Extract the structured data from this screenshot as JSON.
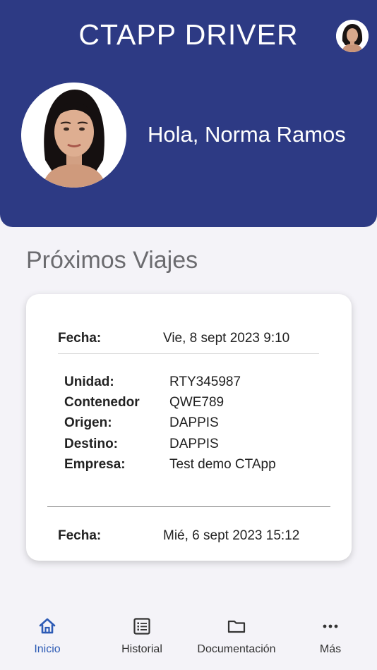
{
  "header": {
    "title": "CTAPP DRIVER",
    "greeting": "Hola, Norma Ramos"
  },
  "section": {
    "title": "Próximos Viajes"
  },
  "trips": [
    {
      "fecha_label": "Fecha:",
      "fecha_value": "Vie, 8 sept 2023 9:10",
      "details": [
        {
          "label": "Unidad:",
          "value": "RTY345987"
        },
        {
          "label": "Contenedor",
          "value": "QWE789"
        },
        {
          "label": "Origen:",
          "value": "DAPPIS"
        },
        {
          "label": "Destino:",
          "value": "DAPPIS"
        },
        {
          "label": "Empresa:",
          "value": "Test demo CTApp"
        }
      ]
    },
    {
      "fecha_label": "Fecha:",
      "fecha_value": "Mié, 6 sept 2023 15:12"
    }
  ],
  "nav": {
    "items": [
      {
        "label": "Inicio",
        "icon": "home-icon",
        "active": true
      },
      {
        "label": "Historial",
        "icon": "list-icon",
        "active": false
      },
      {
        "label": "Documentación",
        "icon": "folder-icon",
        "active": false
      },
      {
        "label": "Más",
        "icon": "more-icon",
        "active": false
      }
    ]
  },
  "colors": {
    "header_bg": "#2d3a84",
    "active_nav": "#2d5bb5",
    "page_bg": "#f4f3f8"
  }
}
